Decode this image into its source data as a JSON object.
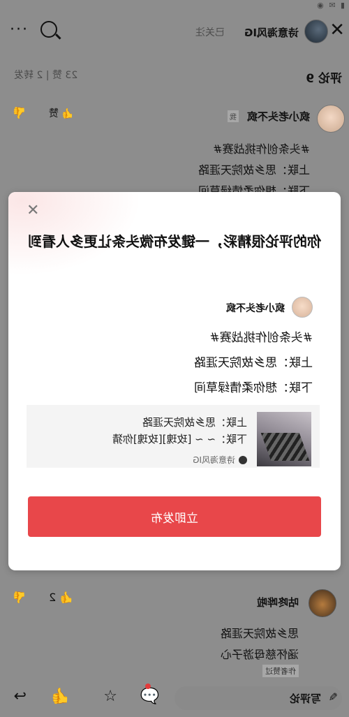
{
  "header": {
    "account_name": "诗意海风IG",
    "follow_status": "已关注",
    "search_icon": "search-icon",
    "more_icon": "more-icon",
    "back_icon": "back-icon"
  },
  "comments_section": {
    "title": "评论 9",
    "stats": "23 赞 | 2 转发"
  },
  "comment1": {
    "author": "疯小老头不疯",
    "author_tag": "我",
    "like_label": "赞",
    "lines": [
      "#头条创作挑战赛#",
      "上联：思乡故院天涯路",
      "下联：想你柔情绿草间"
    ]
  },
  "dialog": {
    "title": "你的评论很精彩，一键发布微头条让更多人看到",
    "preview_author": "疯小老头不疯",
    "preview_lines": [
      "#头条创作挑战赛#",
      "上联：思乡故院天涯路",
      "下联：想你柔情绿草间"
    ],
    "quote_lines": [
      "上联：思乡故院天涯路",
      "下联：~ ~ [玫瑰][玫瑰]你猜"
    ],
    "quote_author": "诗意海风IG",
    "publish_button": "立即发布"
  },
  "comment2": {
    "author": "咕咚哗啦",
    "likes": "2",
    "lines": [
      "思乡故院天涯路",
      "涵怀慈母游子心"
    ],
    "tag": "作者赞过"
  },
  "bottom_bar": {
    "write_comment": "写评论"
  },
  "colors": {
    "accent": "#e8474a",
    "overlay": "#8d8d8d"
  }
}
